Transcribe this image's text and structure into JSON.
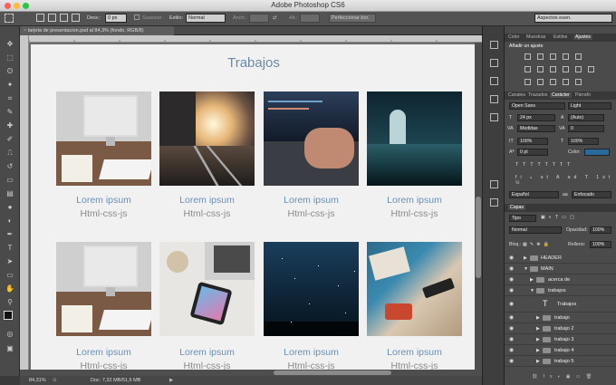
{
  "window": {
    "title": "Adobe Photoshop CS6"
  },
  "options": {
    "desv_label": "Desv.:",
    "desv_value": "0 px",
    "suavizar": "Suavizar",
    "estilo_label": "Estilo:",
    "estilo_value": "Normal",
    "anch_label": "Anch.:",
    "alt_label": "Alt.:",
    "refine_button": "Perfeccionar bor.",
    "workspace": "Aspectos esen."
  },
  "document": {
    "tab_title": "tarjeta de presentacion.psd al 84,3% (fondo, RGB/8)"
  },
  "canvas": {
    "heading": "Trabajos",
    "cards": [
      {
        "title": "Lorem ipsum",
        "subtitle": "Html-css-js",
        "image": "imac-desk-photo"
      },
      {
        "title": "Lorem ipsum",
        "subtitle": "Html-css-js",
        "image": "train-station-sunset-photo"
      },
      {
        "title": "Lorem ipsum",
        "subtitle": "Html-css-js",
        "image": "laptop-typing-photo"
      },
      {
        "title": "Lorem ipsum",
        "subtitle": "Html-css-js",
        "image": "night-cathedral-photo"
      },
      {
        "title": "Lorem ipsum",
        "subtitle": "Html-css-js",
        "image": "imac-desk-photo"
      },
      {
        "title": "Lorem ipsum",
        "subtitle": "Html-css-js",
        "image": "phone-laptop-desk-photo"
      },
      {
        "title": "Lorem ipsum",
        "subtitle": "Html-css-js",
        "image": "starry-night-sky-photo"
      },
      {
        "title": "Lorem ipsum",
        "subtitle": "Html-css-js",
        "image": "blue-desk-items-photo"
      }
    ]
  },
  "status": {
    "zoom": "84,31%",
    "doc": "Doc: 7,32 MB/51,5 MB"
  },
  "panels": {
    "top_tabs": [
      "Color",
      "Muestras",
      "Estilos",
      "Ajustes"
    ],
    "add_adjustment": "Añadir un ajuste",
    "mid_tabs": [
      "Canales",
      "Trazados",
      "Carácter",
      "Párrafo"
    ],
    "font_family": "Open Sans",
    "font_style": "Light",
    "font_size": "24 px",
    "leading": "(Auto)",
    "kerning": "Medidas",
    "tracking": "0",
    "vscale": "100%",
    "hscale": "100%",
    "baseline": "0 pt",
    "color_label": "Color:",
    "language": "Español",
    "antialias": "Enfocado",
    "layers_tab": "Capas",
    "kind_filter": "Tipo",
    "blend_mode": "Normal",
    "opacity_label": "Opacidad:",
    "opacity_value": "100%",
    "lock_label": "Bloq.:",
    "fill_label": "Relleno:",
    "fill_value": "100%",
    "layers": [
      "HEADER",
      "MAIN",
      "acerca de",
      "trabajos",
      "Trabajos",
      "trabajo",
      "trabajo 2",
      "trabajo 3",
      "trabajo 4",
      "trabajo 5"
    ]
  },
  "colors": {
    "heading": "#6a8aa6",
    "caption_title": "#6a90b8",
    "caption_sub": "#8b8b8b",
    "font_color_swatch": "#2a6a9a"
  }
}
